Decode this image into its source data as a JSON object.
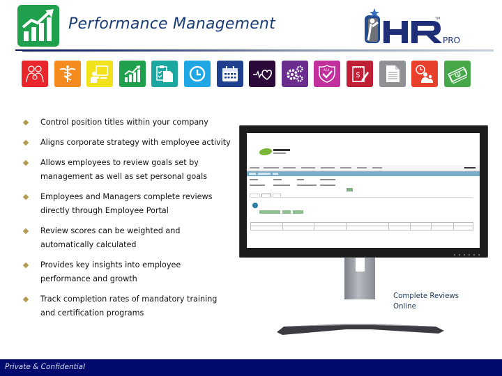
{
  "header": {
    "title": "Performance Management",
    "logo_icon": "growth-chart-icon",
    "brand": {
      "name": "HR",
      "suffix": "PRO",
      "trademark": "TM"
    }
  },
  "module_icons": [
    {
      "name": "people-icon",
      "color": "#e8262b"
    },
    {
      "name": "caduceus-icon",
      "color": "#f58a1f"
    },
    {
      "name": "training-presenter-icon",
      "color": "#f2e21c"
    },
    {
      "name": "growth-chart-icon",
      "color": "#1ea04c"
    },
    {
      "name": "clipboard-checklist-icon",
      "color": "#1aa7a0"
    },
    {
      "name": "clock-icon",
      "color": "#1fa6e4"
    },
    {
      "name": "calendar-icon",
      "color": "#1f3f8f"
    },
    {
      "name": "heartbeat-icon",
      "color": "#2b0a3a"
    },
    {
      "name": "gears-icon",
      "color": "#6b2d8e"
    },
    {
      "name": "aca-shield-icon",
      "color": "#c1309c"
    },
    {
      "name": "expense-report-icon",
      "color": "#c01f36"
    },
    {
      "name": "document-icon",
      "color": "#8f9195"
    },
    {
      "name": "time-attendance-icon",
      "color": "#e8402a"
    },
    {
      "name": "money-icon",
      "color": "#47a84a"
    }
  ],
  "bullets": [
    "Control position titles within your company",
    "Aligns corporate strategy with employee activity",
    "Allows employees to review goals set by management as well as set personal goals",
    "Employees and Managers complete reviews directly through Employee Portal",
    "Review scores can be weighted and automatically calculated",
    "Provides key insights into employee performance and growth",
    "Track completion rates of mandatory training and certification  programs"
  ],
  "monitor": {
    "caption": "Complete Reviews Online"
  },
  "footer": {
    "text": "Private & Confidential",
    "color": "#020a6e"
  }
}
